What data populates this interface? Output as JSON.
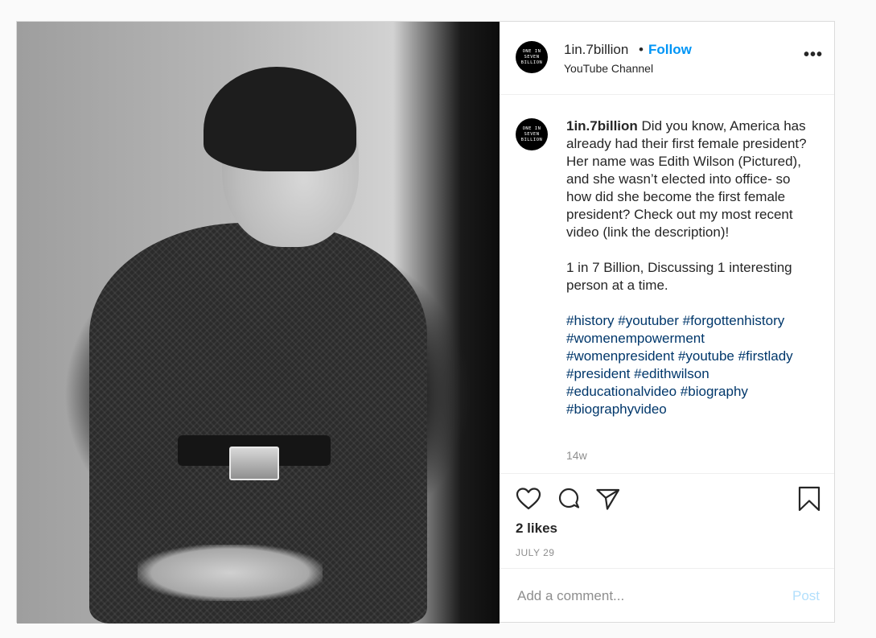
{
  "account": {
    "username": "1in.7billion",
    "follow_label": "Follow",
    "separator": "•",
    "subtitle": "YouTube Channel",
    "avatar_lines": [
      "ONE IN",
      "SEVEN",
      "BILLION"
    ]
  },
  "caption": {
    "username": "1in.7billion",
    "text": "Did you know, America has already had their first female president? Her name was Edith Wilson (Pictured), and she wasn’t elected into office- so how did she become the first female president? Check out my most recent video (link the description)!",
    "text2": "1 in 7 Billion, Discussing 1 interesting person at a time.",
    "hashtags": [
      "#history",
      "#youtuber",
      "#forgottenhistory",
      "#womenempowerment",
      "#womenpresident",
      "#youtube",
      "#firstlady",
      "#president",
      "#edithwilson",
      "#educationalvideo",
      "#biography",
      "#biographyvideo"
    ],
    "age": "14w"
  },
  "actions": {
    "likes": "2 likes",
    "date": "JULY 29",
    "icons": [
      "heart-icon",
      "comment-icon",
      "share-icon",
      "bookmark-icon"
    ]
  },
  "comment": {
    "placeholder": "Add a comment...",
    "post_label": "Post"
  },
  "colors": {
    "link_blue": "#0095f6",
    "hashtag": "#00376b",
    "muted": "#8e8e8e",
    "post_disabled": "#b2dffc"
  }
}
